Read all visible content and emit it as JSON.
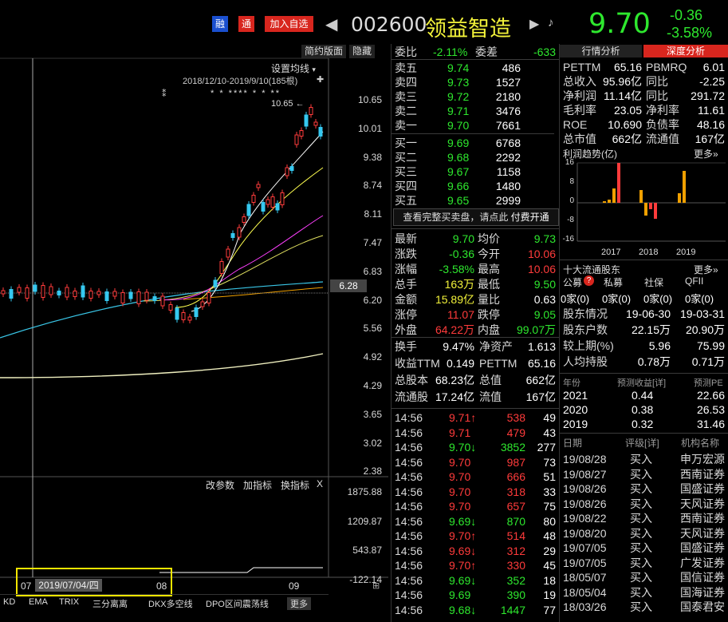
{
  "header": {
    "tag_rong": "融",
    "tag_tong": "通",
    "add_watch": "加入自选",
    "code": "002600",
    "name": "领益智造",
    "price": "9.70",
    "change": "-0.36",
    "change_pct": "-3.58%"
  },
  "chart": {
    "toolbar": [
      "简约版面",
      "隐藏"
    ],
    "ma_setting": "设置均线",
    "range_label": "2018/12/10-2019/9/10(185根)",
    "high_label": "10.65",
    "price_marker": "6.28",
    "y_ticks": [
      "10.65",
      "10.01",
      "9.38",
      "8.74",
      "8.11",
      "7.47",
      "6.83",
      "6.20",
      "5.56",
      "4.92",
      "4.29",
      "3.65",
      "3.02",
      "2.38"
    ],
    "indicator_buttons": [
      "改参数",
      "加指标",
      "换指标"
    ],
    "close_icon": "X",
    "sub_ticks": [
      "1875.88",
      "1209.87",
      "543.87",
      "-122.14"
    ],
    "x_labels": [
      "07",
      "08",
      "09"
    ],
    "cursor_date": "2019/07/04/四",
    "bottom_tabs": [
      "KD",
      "EMA",
      "TRIX",
      "三分离离",
      "DKX多空线",
      "DPO区间震荡线",
      "更多"
    ]
  },
  "quote": {
    "webi": {
      "label": "委比",
      "value": "-2.11%",
      "diff_label": "委差",
      "diff": "-633"
    },
    "asks": [
      {
        "label": "卖五",
        "price": "9.74",
        "vol": "486"
      },
      {
        "label": "卖四",
        "price": "9.73",
        "vol": "1527"
      },
      {
        "label": "卖三",
        "price": "9.72",
        "vol": "2180"
      },
      {
        "label": "卖二",
        "price": "9.71",
        "vol": "3476"
      },
      {
        "label": "卖一",
        "price": "9.70",
        "vol": "7661"
      }
    ],
    "bids": [
      {
        "label": "买一",
        "price": "9.69",
        "vol": "6768"
      },
      {
        "label": "买二",
        "price": "9.68",
        "vol": "2292"
      },
      {
        "label": "买三",
        "price": "9.67",
        "vol": "1158"
      },
      {
        "label": "买四",
        "price": "9.66",
        "vol": "1480"
      },
      {
        "label": "买五",
        "price": "9.65",
        "vol": "2999"
      }
    ],
    "full_book": "查看完整买卖盘，请点此",
    "paid": "付费开通",
    "stats": [
      {
        "l1": "最新",
        "v1": "9.70",
        "l2": "均价",
        "v2": "9.73"
      },
      {
        "l1": "涨跌",
        "v1": "-0.36",
        "l2": "今开",
        "v2": "10.06"
      },
      {
        "l1": "涨幅",
        "v1": "-3.58%",
        "l2": "最高",
        "v2": "10.06"
      },
      {
        "l1": "总手",
        "v1": "163万",
        "l2": "最低",
        "v2": "9.50"
      },
      {
        "l1": "金额",
        "v1": "15.89亿",
        "l2": "量比",
        "v2": "0.63"
      },
      {
        "l1": "涨停",
        "v1": "11.07",
        "l2": "跌停",
        "v2": "9.05"
      },
      {
        "l1": "外盘",
        "v1": "64.22万",
        "l2": "内盘",
        "v2": "99.07万"
      }
    ],
    "fund": [
      {
        "l1": "换手",
        "v1": "9.47%",
        "l2": "净资产",
        "v2": "1.613"
      },
      {
        "l1": "收益TTM",
        "v1": "0.149",
        "l2": "PETTM",
        "v2": "65.16"
      },
      {
        "l1": "总股本",
        "v1": "68.23亿",
        "l2": "总值",
        "v2": "662亿"
      },
      {
        "l1": "流通股",
        "v1": "17.24亿",
        "l2": "流值",
        "v2": "167亿"
      }
    ],
    "ticks": [
      {
        "t": "14:56",
        "p": "9.71",
        "d": "↑",
        "v": "538",
        "n": "49",
        "c": "red"
      },
      {
        "t": "14:56",
        "p": "9.71",
        "d": "",
        "v": "479",
        "n": "43",
        "c": "red"
      },
      {
        "t": "14:56",
        "p": "9.70",
        "d": "↓",
        "v": "3852",
        "n": "277",
        "c": "green"
      },
      {
        "t": "14:56",
        "p": "9.70",
        "d": "",
        "v": "987",
        "n": "73",
        "c": "red"
      },
      {
        "t": "14:56",
        "p": "9.70",
        "d": "",
        "v": "666",
        "n": "51",
        "c": "red"
      },
      {
        "t": "14:56",
        "p": "9.70",
        "d": "",
        "v": "318",
        "n": "33",
        "c": "red"
      },
      {
        "t": "14:56",
        "p": "9.70",
        "d": "",
        "v": "657",
        "n": "75",
        "c": "red"
      },
      {
        "t": "14:56",
        "p": "9.69",
        "d": "↓",
        "v": "870",
        "n": "80",
        "c": "green"
      },
      {
        "t": "14:56",
        "p": "9.70",
        "d": "↑",
        "v": "514",
        "n": "48",
        "c": "red"
      },
      {
        "t": "14:56",
        "p": "9.69",
        "d": "↓",
        "v": "312",
        "n": "29",
        "c": "red"
      },
      {
        "t": "14:56",
        "p": "9.70",
        "d": "↑",
        "v": "330",
        "n": "45",
        "c": "red"
      },
      {
        "t": "14:56",
        "p": "9.69",
        "d": "↓",
        "v": "352",
        "n": "18",
        "c": "green"
      },
      {
        "t": "14:56",
        "p": "9.69",
        "d": "",
        "v": "390",
        "n": "19",
        "c": "green"
      },
      {
        "t": "14:56",
        "p": "9.68",
        "d": "↓",
        "v": "1447",
        "n": "77",
        "c": "green"
      }
    ]
  },
  "analysis": {
    "tabs": [
      "行情分析",
      "深度分析"
    ],
    "rows": [
      {
        "l1": "PETTM",
        "v1": "65.16",
        "l2": "PBMRQ",
        "v2": "6.01",
        "c2": "white"
      },
      {
        "l1": "总收入",
        "v1": "95.96亿",
        "l2": "同比",
        "v2": "-2.25",
        "c2": "white"
      },
      {
        "l1": "净利润",
        "v1": "11.14亿",
        "l2": "同比",
        "v2": "291.72",
        "c2": "white"
      },
      {
        "l1": "毛利率",
        "v1": "23.05",
        "l2": "净利率",
        "v2": "11.61",
        "c2": "white"
      },
      {
        "l1": "ROE",
        "v1": "10.690",
        "l2": "负债率",
        "v2": "48.16",
        "c2": "white"
      },
      {
        "l1": "总市值",
        "v1": "662亿",
        "l2": "流通值",
        "v2": "167亿",
        "c2": "white"
      }
    ],
    "profit_trend": "利润趋势(亿)",
    "more": "更多»",
    "profit_ticks": [
      "16",
      "8",
      "0",
      "-8",
      "-16"
    ],
    "profit_years": [
      "2017",
      "2018",
      "2019"
    ],
    "holders_title": "十大流通股东",
    "holders_cols": [
      "公募",
      "私募",
      "社保",
      "QFII"
    ],
    "holders_vals": [
      "0家(0)",
      "0家(0)",
      "0家(0)",
      "0家(0)"
    ],
    "holder_rows": [
      {
        "l": "股东情况",
        "a": "19-06-30",
        "b": "19-03-31"
      },
      {
        "l": "股东户数",
        "a": "22.15万",
        "b": "20.90万"
      },
      {
        "l": "较上期(%)",
        "a": "5.96",
        "b": "75.99"
      },
      {
        "l": "人均持股",
        "a": "0.78万",
        "b": "0.71万"
      }
    ],
    "forecast_cols": [
      "年份",
      "预测收益[详]",
      "预测PE"
    ],
    "forecast": [
      {
        "y": "2021",
        "e": "0.44",
        "pe": "22.66"
      },
      {
        "y": "2020",
        "e": "0.38",
        "pe": "26.53"
      },
      {
        "y": "2019",
        "e": "0.32",
        "pe": "31.46"
      }
    ],
    "rating_cols": [
      "日期",
      "评级[详]",
      "机构名称"
    ],
    "ratings": [
      {
        "d": "19/08/28",
        "r": "买入",
        "o": "申万宏源"
      },
      {
        "d": "19/08/27",
        "r": "买入",
        "o": "西南证券"
      },
      {
        "d": "19/08/26",
        "r": "买入",
        "o": "国盛证券"
      },
      {
        "d": "19/08/26",
        "r": "买入",
        "o": "天风证券"
      },
      {
        "d": "19/08/22",
        "r": "买入",
        "o": "西南证券"
      },
      {
        "d": "19/08/20",
        "r": "买入",
        "o": "天风证券"
      },
      {
        "d": "19/07/05",
        "r": "买入",
        "o": "国盛证券"
      },
      {
        "d": "19/07/05",
        "r": "买入",
        "o": "广发证券"
      },
      {
        "d": "18/05/07",
        "r": "买入",
        "o": "国信证券"
      },
      {
        "d": "18/05/04",
        "r": "买入",
        "o": "国海证券"
      },
      {
        "d": "18/03/26",
        "r": "买入",
        "o": "国泰君安"
      }
    ]
  },
  "colors": {
    "up": "#ff3b3b",
    "down": "#2ee82e",
    "accent": "#f3f33a"
  }
}
